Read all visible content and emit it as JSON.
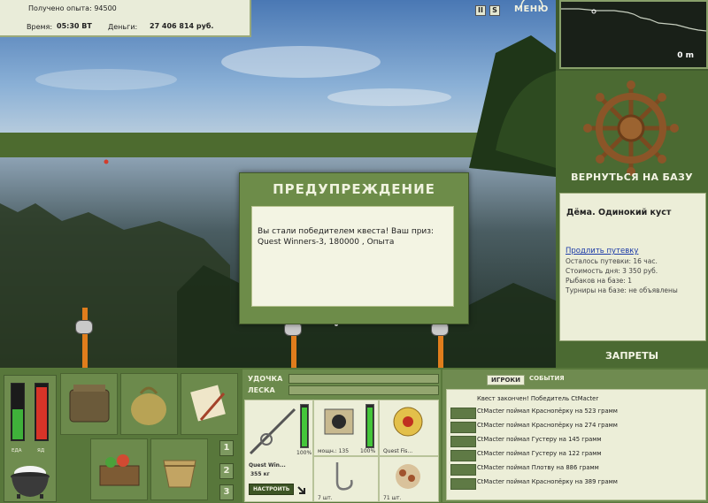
{
  "hud": {
    "experience_label": "Получено опыта: 94500",
    "time_label": "Время:",
    "time_value": "05:30 ВТ",
    "money_label": "Деньги:",
    "money_value": "27 406 814 руб."
  },
  "topbar": {
    "pause_label": "II",
    "sound_label": "S",
    "menu_label": "МЕНЮ"
  },
  "minimap": {
    "depth_readout": "0 m"
  },
  "sidebar": {
    "return_button": "ВЕРНУТЬСЯ НА БАЗУ",
    "location_name": "Дёма. Одинокий куст",
    "extend_link": "Продлить путевку",
    "info_lines": [
      "Осталось путевки: 16 час.",
      "Стоимость дня: 3 350 руб.",
      "Рыбаков на базе: 1",
      "Турниры на базе: не объявлены"
    ],
    "bans_button": "ЗАПРЕТЫ"
  },
  "dialog": {
    "title": "ПРЕДУПРЕЖДЕНИЕ",
    "message": "Вы стали победителем квеста! Ваш приз: Quest Winners-3, 180000 , Опыта"
  },
  "meters": {
    "food_label": "ЕДА",
    "poison_label": "ЯД",
    "food_level": 0.55,
    "poison_level": 0.95
  },
  "slots": {
    "numbers": [
      "1",
      "2",
      "3"
    ]
  },
  "tackle": {
    "rod_label": "УДОЧКА",
    "line_label": "ЛЕСКА",
    "rod_name": "Quest Win...",
    "rod_weight": "355 кг",
    "rod_percent": "100%",
    "setup_button": "НАСТРОИТЬ",
    "reel_caption": "мощн.: 135",
    "reel_percent": "100%",
    "line_caption": "Quest Fis...",
    "hook_caption": "7 шт.",
    "bait_caption": "71 шт."
  },
  "events": {
    "tab_players": "ИГРОКИ",
    "tab_events": "СОБЫТИЯ",
    "header": "Квест закончен! Победитель CtMacter",
    "rows": [
      "CtMacter поймал Краснопёрку на 523 грамм",
      "CtMacter поймал Краснопёрку на 274 грамм",
      "CtMacter поймал Густеру на 145 грамм",
      "CtMacter поймал Густеру на 122 грамм",
      "CtMacter поймал Плотву на 886 грамм",
      "CtMacter поймал Краснопёрку на 389 грамм"
    ]
  }
}
